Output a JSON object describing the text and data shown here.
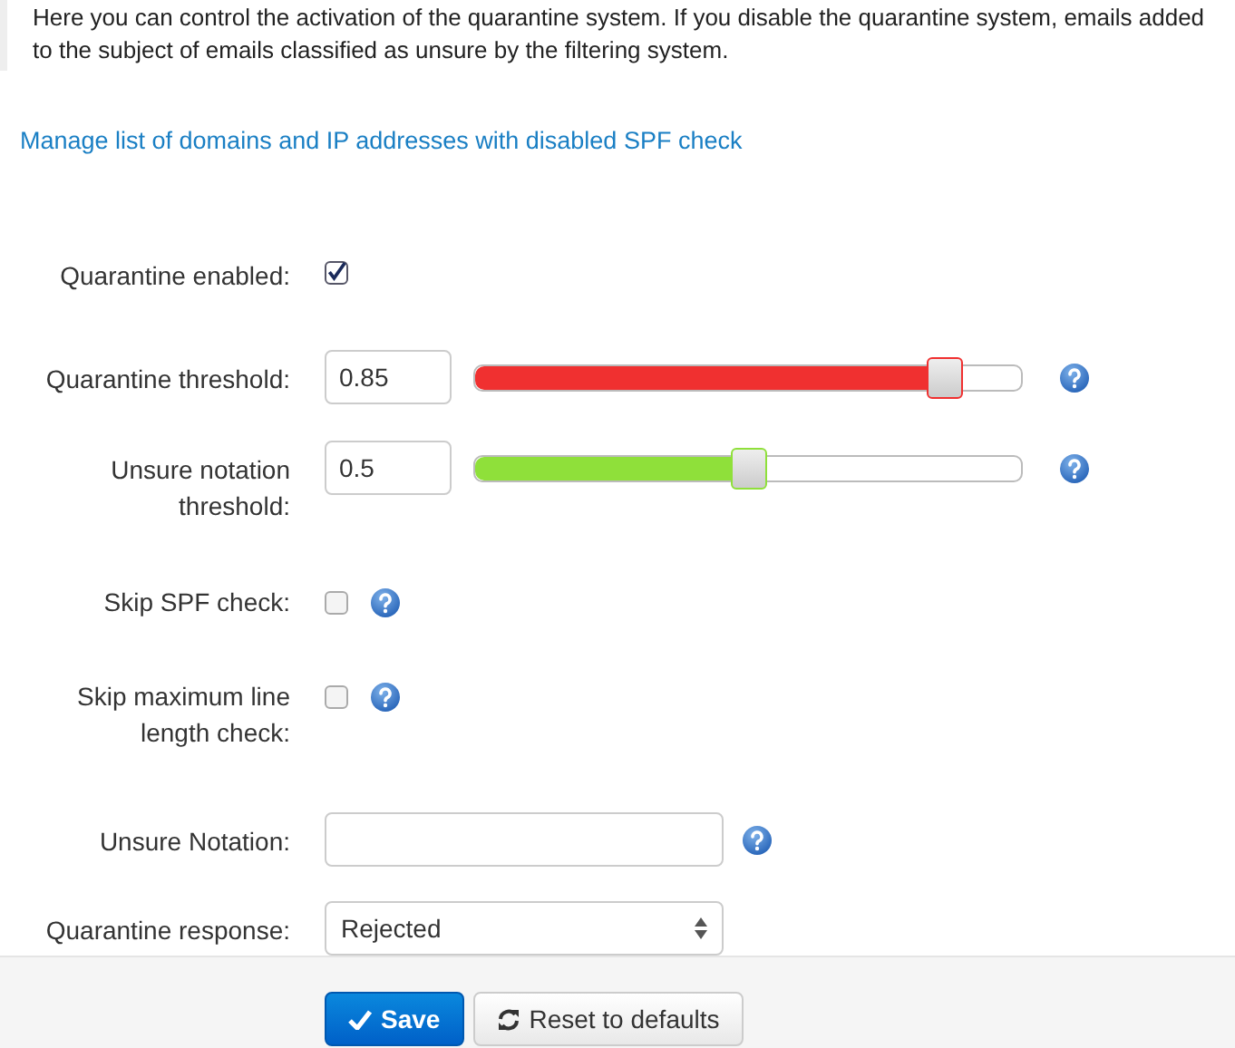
{
  "intro": "Here you can control the activation of the quarantine system. If you disable the quarantine system, emails added to the subject of emails classified as unsure by the filtering system.",
  "link": "Manage list of domains and IP addresses with disabled SPF check",
  "fields": [
    {
      "kind": "checkbox",
      "label": "Quarantine enabled:",
      "checked": true,
      "help": false
    },
    {
      "kind": "slider",
      "label": "Quarantine threshold:",
      "value": "0.85",
      "level": 0.86,
      "color": "#f03030",
      "help": true
    },
    {
      "kind": "slider",
      "label": "Unsure notation threshold:",
      "value": "0.5",
      "level": 0.5,
      "color": "#8fe03a",
      "help": true
    },
    {
      "kind": "checkbox",
      "label": "Skip SPF check:",
      "checked": false,
      "help": true
    },
    {
      "kind": "checkbox",
      "label": "Skip maximum line length check:",
      "checked": false,
      "help": true
    },
    {
      "kind": "text",
      "label": "Unsure Notation:",
      "help": true
    },
    {
      "kind": "select",
      "label": "Quarantine response:",
      "value": "Rejected",
      "help": false
    }
  ],
  "buttons": [
    {
      "kind": "primary",
      "label": "Save"
    },
    {
      "kind": "default",
      "label": "Reset to defaults"
    }
  ]
}
